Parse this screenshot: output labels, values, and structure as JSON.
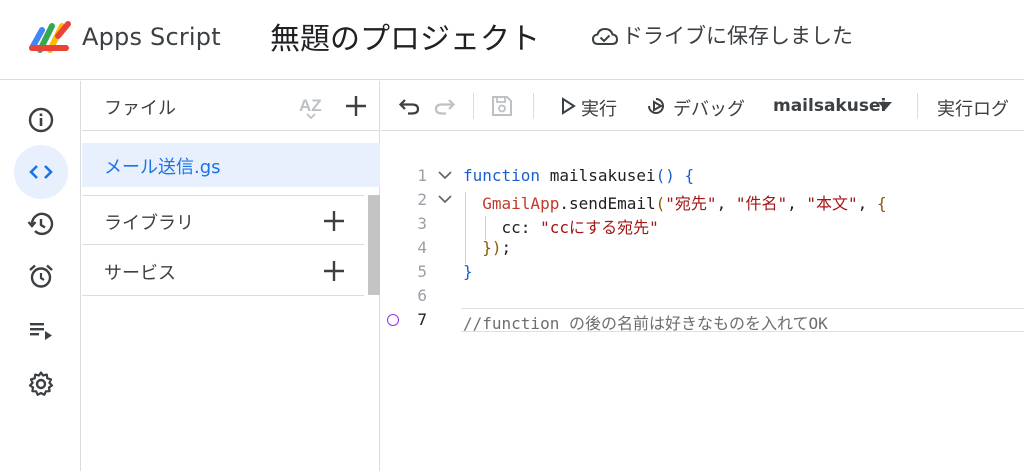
{
  "header": {
    "app_name": "Apps Script",
    "project_title": "無題のプロジェクト",
    "save_status": "ドライブに保存しました"
  },
  "rail": {
    "items": [
      {
        "icon": "info-icon",
        "active": false
      },
      {
        "icon": "code-icon",
        "active": true
      },
      {
        "icon": "history-icon",
        "active": false
      },
      {
        "icon": "alarm-icon",
        "active": false
      },
      {
        "icon": "executions-icon",
        "active": false
      },
      {
        "icon": "settings-icon",
        "active": false
      }
    ]
  },
  "panel": {
    "files_label": "ファイル",
    "sort_icon_text": "AZ",
    "files": [
      "メール送信.gs"
    ],
    "libraries_label": "ライブラリ",
    "services_label": "サービス"
  },
  "toolbar": {
    "run_label": "実行",
    "debug_label": "デバッグ",
    "function_name": "mailsakusei",
    "log_label": "実行ログ"
  },
  "editor": {
    "line_numbers": [
      "1",
      "2",
      "3",
      "4",
      "5",
      "6",
      "7"
    ],
    "lines": {
      "l1_kw": "function",
      "l1_name": " mailsakusei",
      "l1_paren": "()",
      "l1_brace": " {",
      "l2_obj": "GmailApp",
      "l2_method": ".sendEmail",
      "l2_open": "(",
      "l2_arg1": "\"宛先\"",
      "l2_arg2": "\"件名\"",
      "l2_arg3": "\"本文\"",
      "l2_brace": "{",
      "l3_key": "cc: ",
      "l3_val": "\"ccにする宛先\"",
      "l4_close": "})",
      "l4_semi": ";",
      "l5_close": "}",
      "l7_comment": "//function の後の名前は好きなものを入れてOK"
    }
  },
  "colors": {
    "accent": "#1a73e8",
    "active_bg": "#e8f0fe",
    "keyword": "#1a5fd0",
    "string": "#a31515",
    "breakpoint": "#9334e6"
  }
}
